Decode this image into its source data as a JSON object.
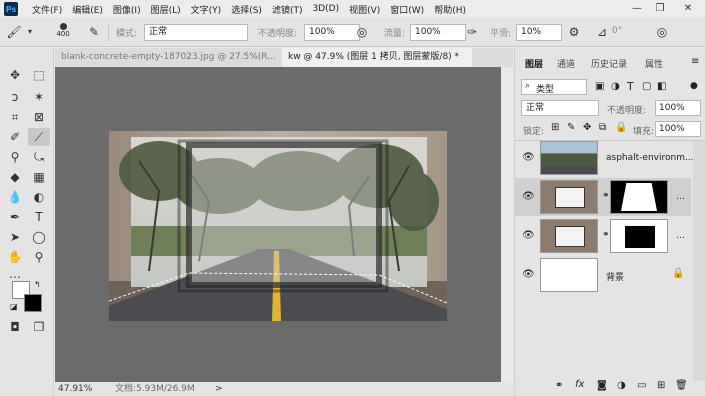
{
  "app": {
    "logo": "Ps"
  },
  "menu": [
    "文件(F)",
    "编辑(E)",
    "图像(I)",
    "图层(L)",
    "文字(Y)",
    "选择(S)",
    "滤镜(T)",
    "3D(D)",
    "视图(V)",
    "窗口(W)",
    "帮助(H)"
  ],
  "options": {
    "brush_size": "400",
    "mode_label": "模式:",
    "mode_value": "正常",
    "opacity_label": "不透明度:",
    "opacity_value": "100%",
    "flow_label": "流量:",
    "flow_value": "100%",
    "smooth_label": "平滑:",
    "smooth_value": "10%",
    "angle_value": "0°"
  },
  "tabs": [
    {
      "label": "blank-concrete-empty-187023.jpg @ 27.5%(R..."
    },
    {
      "label": "kw @ 47.9% (图层 1 拷贝, 图层蒙版/8) *"
    }
  ],
  "status": {
    "zoom": "47.91%",
    "doc": "文档:5.93M/26.9M",
    "arrow": ">"
  },
  "panel": {
    "tabs": [
      "图层",
      "通道",
      "历史记录",
      "属性"
    ],
    "filter_label": "类型",
    "blend_mode": "正常",
    "opacity_label": "不透明度:",
    "opacity_value": "100%",
    "lock_label": "锁定:",
    "fill_label": "填充:",
    "fill_value": "100%",
    "layers": [
      {
        "name": "asphalt-environm..."
      },
      {
        "name": ""
      },
      {
        "name": ""
      },
      {
        "name": "背景"
      }
    ],
    "footer_icons": [
      "link-icon",
      "fx-icon",
      "mask-icon",
      "adjustment-icon",
      "group-icon",
      "new-layer-icon",
      "trash-icon"
    ]
  },
  "colors": {
    "workspace": "#6b6b6b",
    "accent": "#31a8ff"
  }
}
